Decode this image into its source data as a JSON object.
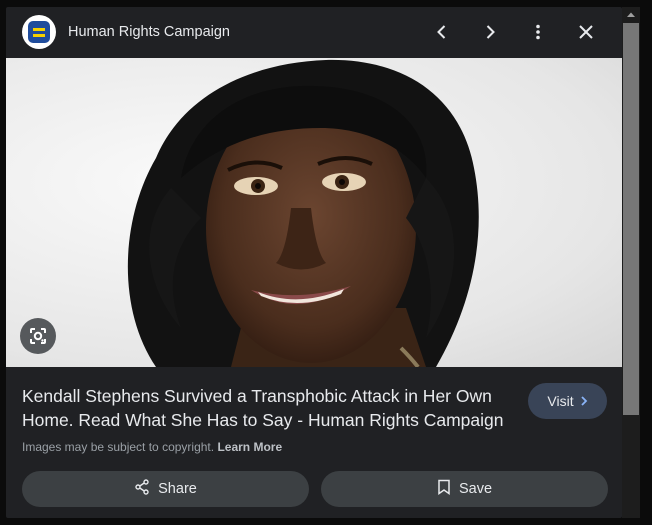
{
  "header": {
    "source_name": "Human Rights Campaign",
    "logo_icon": "hrc-logo",
    "controls": [
      "chevron-left-icon",
      "chevron-right-icon",
      "more-vert-icon",
      "close-icon"
    ]
  },
  "image": {
    "lens_icon": "google-lens-icon"
  },
  "result": {
    "title": "Kendall Stephens Survived a Transphobic Attack in Her Own Home. Read What She Has to Say - Human Rights Campaign",
    "visit_label": "Visit",
    "copyright_text": "Images may be subject to copyright.",
    "learn_more": "Learn More"
  },
  "actions": {
    "share_label": "Share",
    "save_label": "Save"
  },
  "colors": {
    "panel_bg": "#202124",
    "visit_bg": "#394457",
    "action_bg": "#3c4043",
    "logo_blue": "#1f4c9c",
    "logo_yellow": "#f5d000"
  }
}
